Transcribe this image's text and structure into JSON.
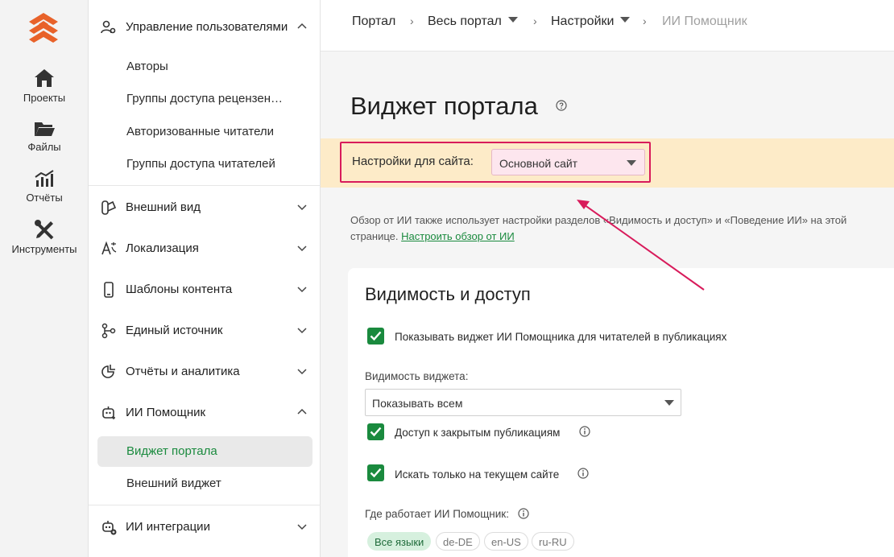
{
  "rail": {
    "items": [
      {
        "label": "Проекты",
        "icon": "home-icon"
      },
      {
        "label": "Файлы",
        "icon": "folder-icon"
      },
      {
        "label": "Отчёты",
        "icon": "chart-icon"
      },
      {
        "label": "Инструменты",
        "icon": "tools-icon"
      }
    ]
  },
  "nav": {
    "user_mgmt": "Управление пользователями",
    "user_mgmt_items": [
      "Авторы",
      "Группы доступа рецензен…",
      "Авторизованные читатели",
      "Группы доступа читателей"
    ],
    "appearance": "Внешний вид",
    "localization": "Локализация",
    "templates": "Шаблоны контента",
    "single_source": "Единый источник",
    "reports": "Отчёты и аналитика",
    "ai_assistant": "ИИ Помощник",
    "ai_items": [
      "Виджет портала",
      "Внешний виджет"
    ],
    "ai_integrations": "ИИ интеграции"
  },
  "breadcrumbs": {
    "portal": "Портал",
    "all_portal": "Весь портал",
    "settings": "Настройки",
    "current": "ИИ Помощник"
  },
  "page": {
    "title": "Виджет портала",
    "site_settings_label": "Настройки для сайта:",
    "site_select_value": "Основной сайт",
    "info_text": "Обзор от ИИ также использует настройки разделов «Видимость и доступ» и «Поведение ИИ» на этой странице.",
    "info_link": "Настроить обзор от ИИ"
  },
  "visibility": {
    "heading": "Видимость и доступ",
    "show_widget": "Показывать виджет ИИ Помощника для читателей в публикациях",
    "widget_visibility_label": "Видимость виджета:",
    "widget_visibility_value": "Показывать всем",
    "closed_access": "Доступ к закрытым публикациям",
    "current_site_only": "Искать только на текущем сайте",
    "where_works": "Где работает ИИ Помощник:",
    "languages": [
      "Все языки",
      "de-DE",
      "en-US",
      "ru-RU"
    ]
  },
  "colors": {
    "accent_green": "#1a8a3e",
    "brand_orange": "#e8622a",
    "highlight_pink": "#d81b5b",
    "banner_yellow": "#fdebc8"
  }
}
